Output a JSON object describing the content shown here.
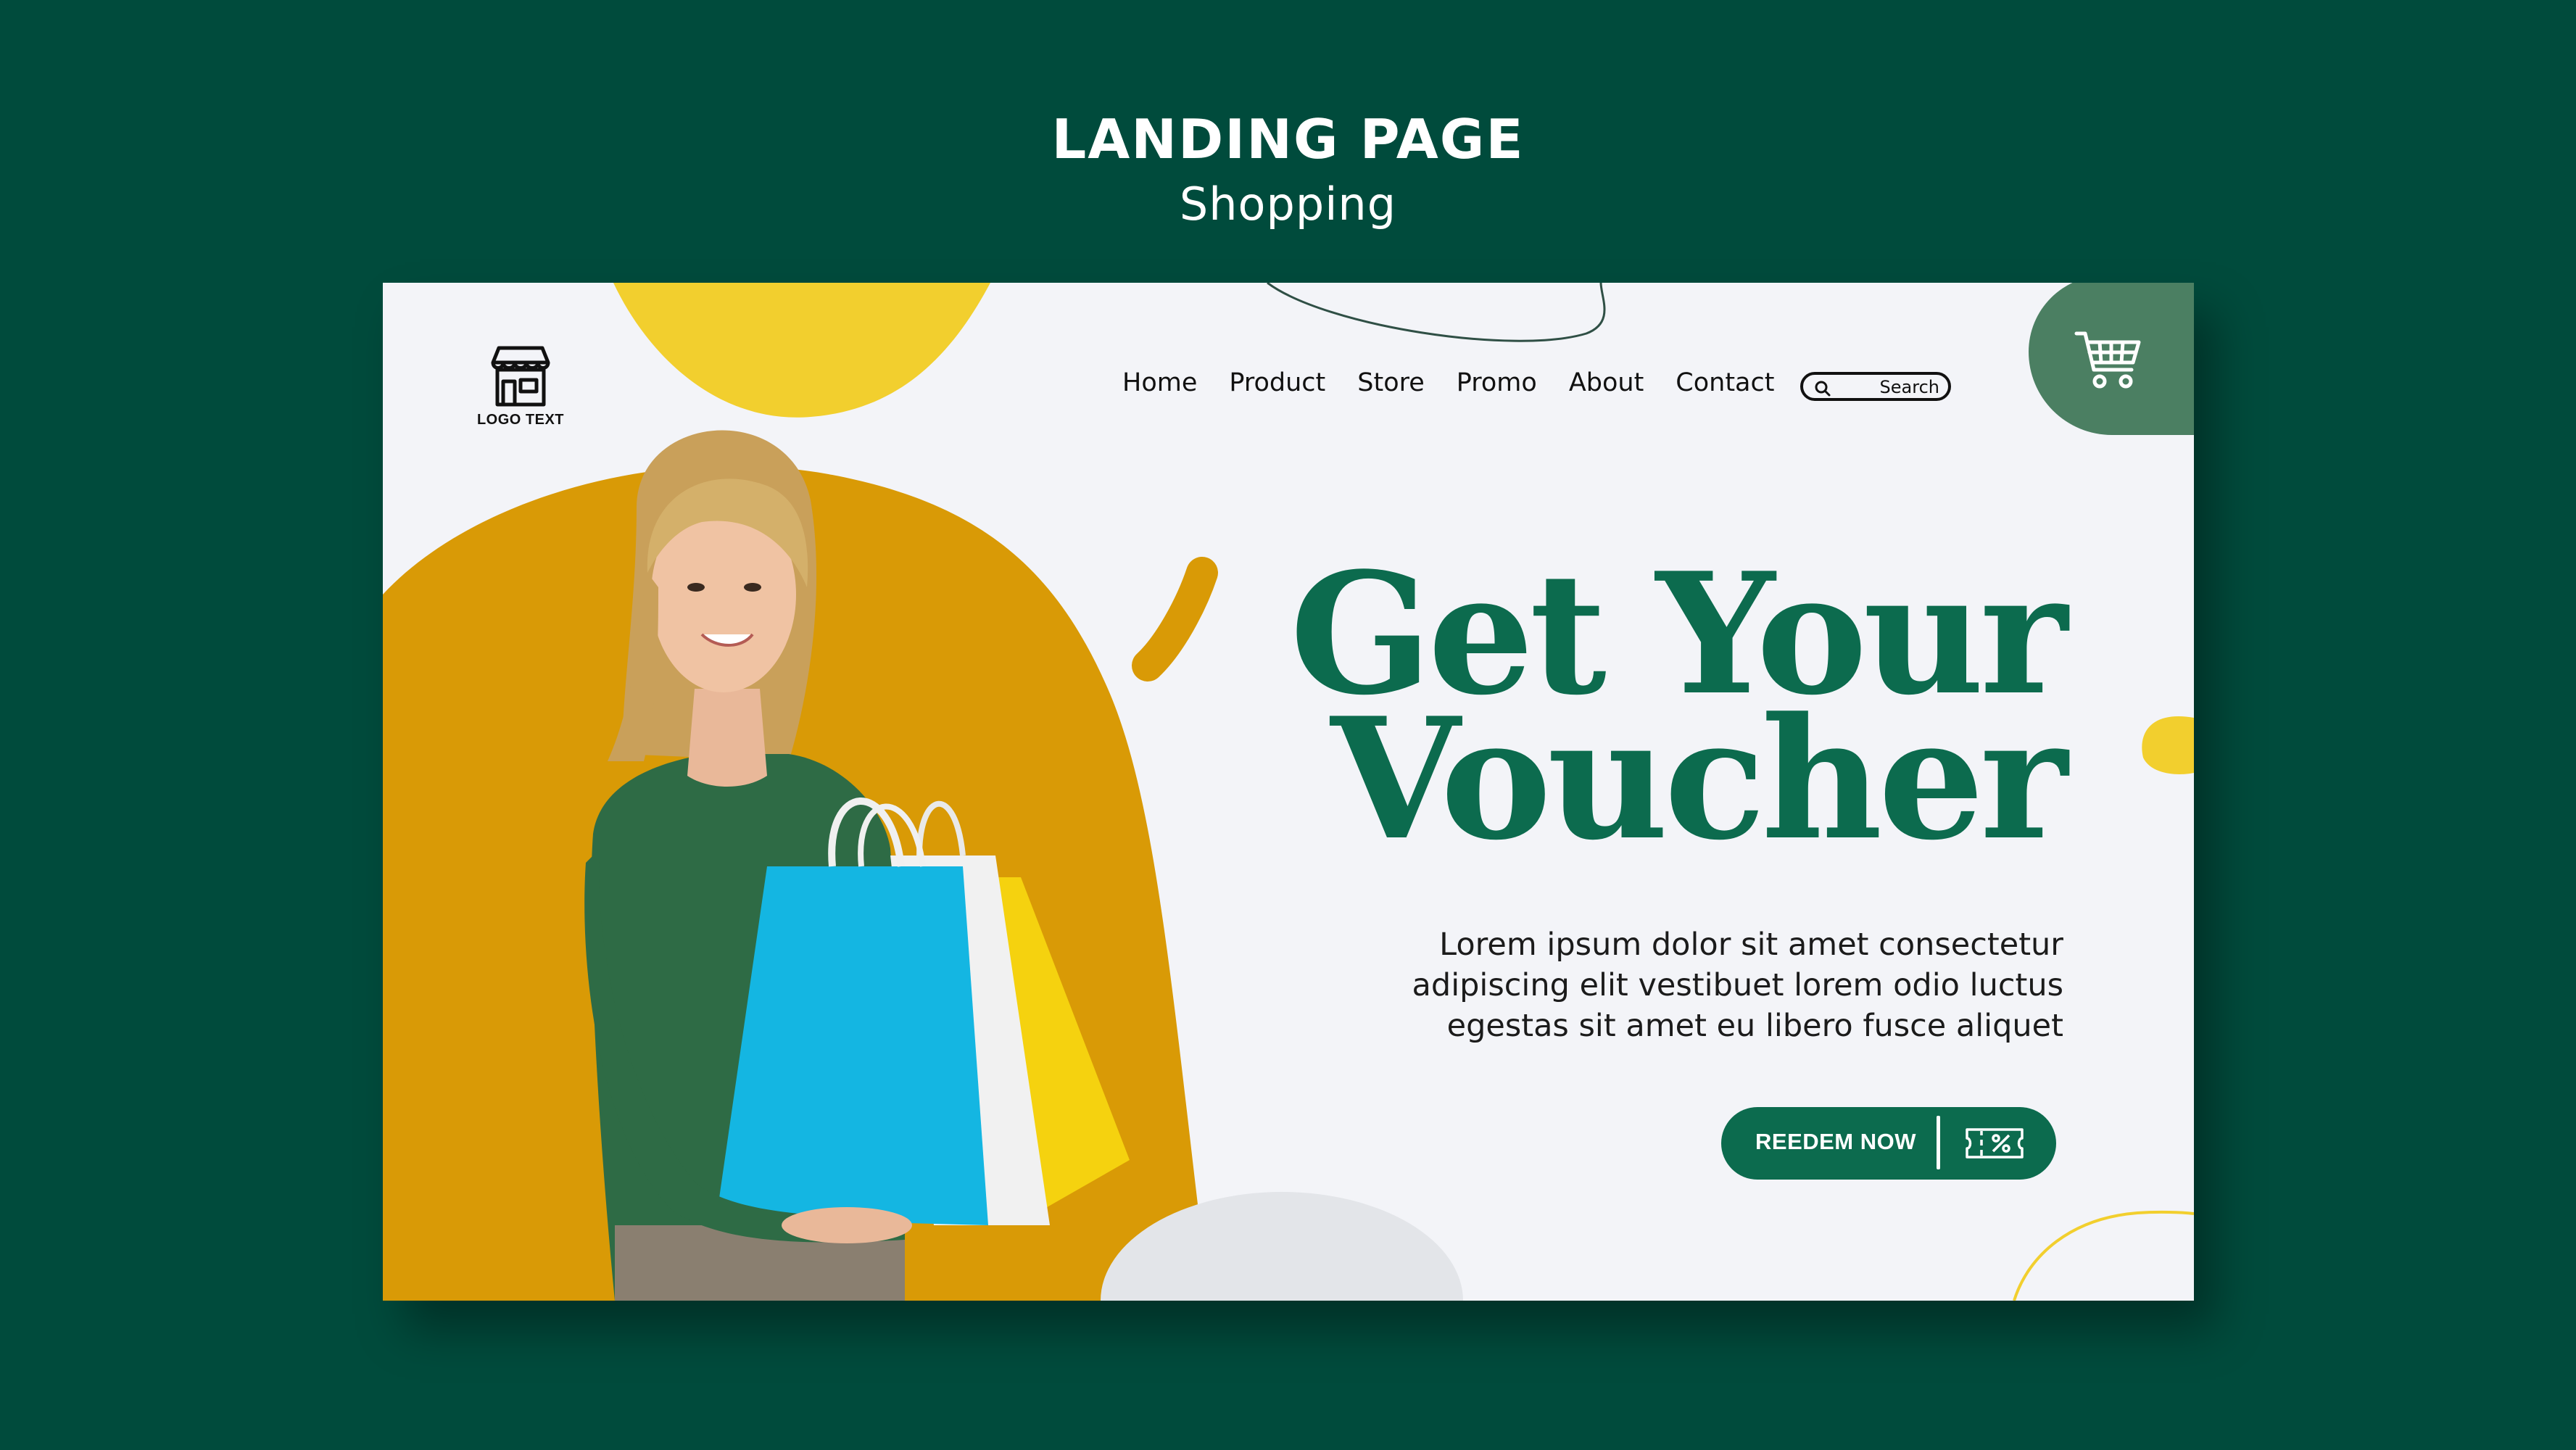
{
  "header": {
    "title": "LANDING PAGE",
    "subtitle": "Shopping"
  },
  "site": {
    "logo_text": "LOGO TEXT",
    "nav": [
      "Home",
      "Product",
      "Store",
      "Promo",
      "About",
      "Contact"
    ],
    "search": {
      "placeholder": "Search"
    }
  },
  "hero": {
    "headline_line1": "Get Your",
    "headline_line2": "Voucher",
    "body_line1": "Lorem ipsum dolor sit amet consectetur",
    "body_line2": "adipiscing elit vestibuet lorem odio luctus",
    "body_line3": "egestas sit amet eu libero fusce aliquet",
    "cta_label": "REEDEM NOW"
  },
  "colors": {
    "background": "#004b3c",
    "card": "#f3f4f8",
    "accent_green": "#0c6b4e",
    "cart_green": "#4b7f62",
    "orange": "#d99a06",
    "yellow": "#f2cf2e"
  },
  "icons": {
    "logo": "storefront-icon",
    "search": "search-icon",
    "cart": "shopping-cart-icon",
    "cta": "voucher-ticket-icon"
  }
}
